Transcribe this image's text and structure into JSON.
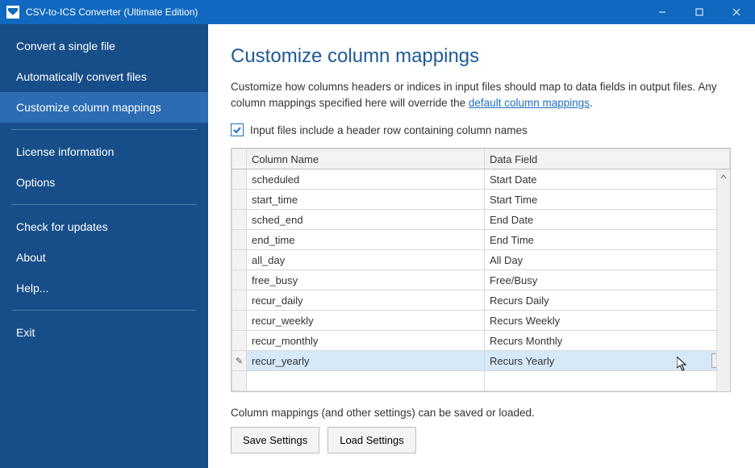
{
  "window": {
    "title": "CSV-to-ICS Converter (Ultimate Edition)"
  },
  "sidebar": {
    "items": [
      {
        "label": "Convert a single file"
      },
      {
        "label": "Automatically convert files"
      },
      {
        "label": "Customize column mappings"
      },
      {
        "label": "License information"
      },
      {
        "label": "Options"
      },
      {
        "label": "Check for updates"
      },
      {
        "label": "About"
      },
      {
        "label": "Help..."
      },
      {
        "label": "Exit"
      }
    ]
  },
  "main": {
    "heading": "Customize column mappings",
    "desc_prefix": "Customize how columns headers or indices in input files should map to data fields in output files. Any column mappings specified here will override the ",
    "desc_link": "default column mappings",
    "desc_suffix": ".",
    "checkbox_label": "Input files include a header row containing column names",
    "checkbox_checked": true,
    "grid": {
      "headers": {
        "col1": "Column Name",
        "col2": "Data Field"
      },
      "rows": [
        {
          "name": "scheduled",
          "field": "Start Date"
        },
        {
          "name": "start_time",
          "field": "Start Time"
        },
        {
          "name": "sched_end",
          "field": "End Date"
        },
        {
          "name": "end_time",
          "field": "End Time"
        },
        {
          "name": "all_day",
          "field": "All Day"
        },
        {
          "name": "free_busy",
          "field": "Free/Busy"
        },
        {
          "name": "recur_daily",
          "field": "Recurs Daily"
        },
        {
          "name": "recur_weekly",
          "field": "Recurs Weekly"
        },
        {
          "name": "recur_monthly",
          "field": "Recurs Monthly"
        },
        {
          "name": "recur_yearly",
          "field": "Recurs Yearly"
        }
      ],
      "selected_row_index": 9
    },
    "save_note": "Column mappings (and other settings) can be saved or loaded.",
    "buttons": {
      "save": "Save Settings",
      "load": "Load Settings"
    }
  }
}
